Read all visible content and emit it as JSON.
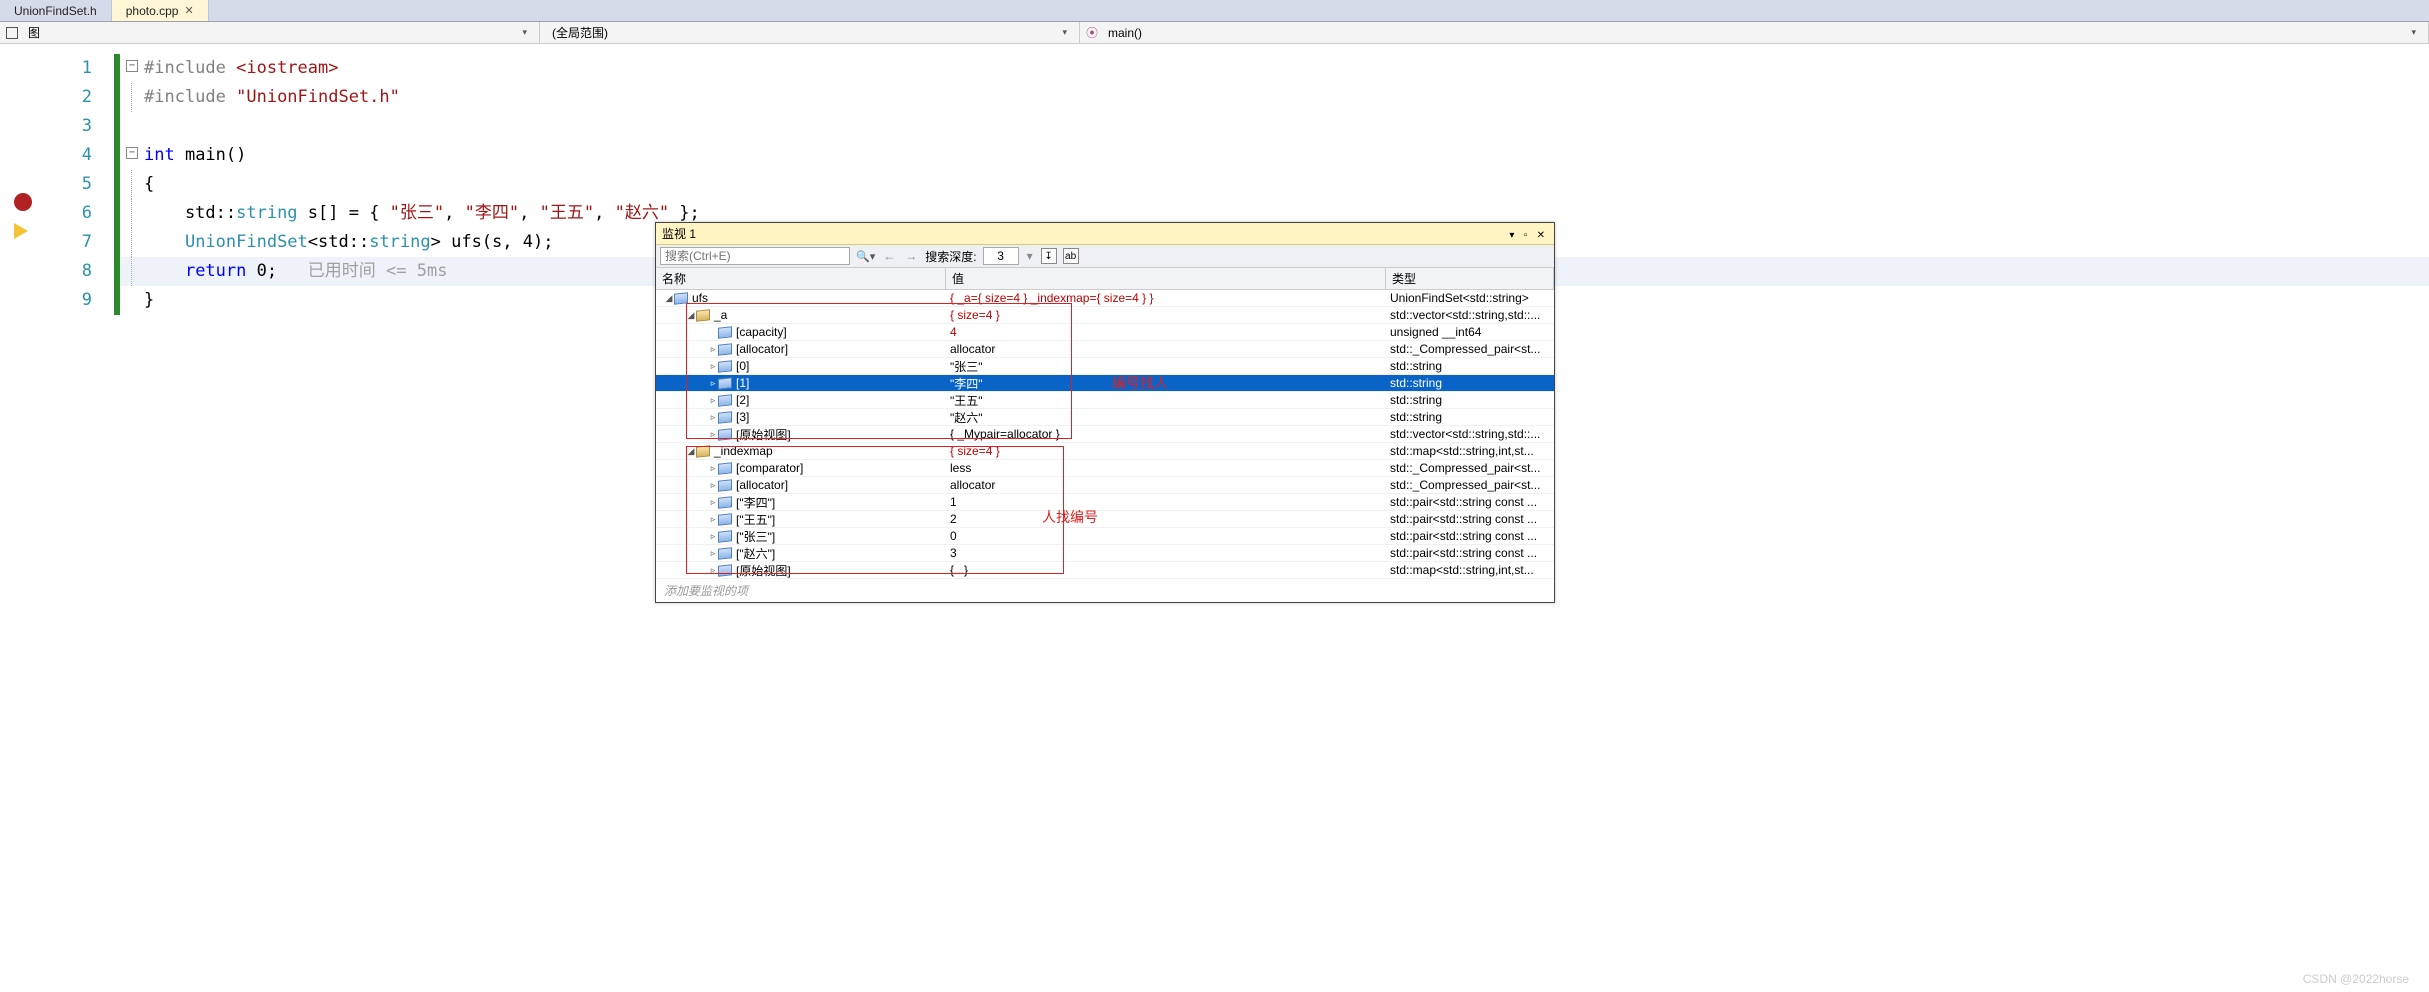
{
  "tabs": {
    "inactive": "UnionFindSet.h",
    "active": "photo.cpp",
    "close": "✕"
  },
  "nav": {
    "left_icon_label": "图",
    "mid": "(全局范围)",
    "right_icon": "⦿",
    "right": "main()"
  },
  "gutter": {
    "lines": [
      "1",
      "2",
      "3",
      "4",
      "5",
      "6",
      "7",
      "8",
      "9"
    ]
  },
  "code": {
    "l1a": "#include ",
    "l1b": "<iostream>",
    "l2a": "#include ",
    "l2b": "\"UnionFindSet.h\"",
    "l4a": "int",
    "l4b": " main()",
    "l5": "{",
    "l6a": "    std::",
    "l6b": "string",
    "l6c": " s[] = { ",
    "l6d": "\"张三\"",
    "l6e": ", ",
    "l6f": "\"李四\"",
    "l6g": ", ",
    "l6h": "\"王五\"",
    "l6i": ", ",
    "l6j": "\"赵六\"",
    "l6k": " };",
    "l7a": "    ",
    "l7b": "UnionFindSet",
    "l7c": "<std::",
    "l7d": "string",
    "l7e": "> ufs(s, ",
    "l7f": "4",
    "l7g": ");",
    "l8a": "    ",
    "l8b": "return",
    "l8c": " 0;   ",
    "l8d": "已用时间 <= 5ms",
    "l9": "}"
  },
  "watch": {
    "title": "监视 1",
    "search_placeholder": "搜索(Ctrl+E)",
    "depth_label": "搜索深度:",
    "depth_value": "3",
    "nav_back": "←",
    "nav_fwd": "→",
    "tool1": "↧",
    "tool2": "ab",
    "headers": {
      "name": "名称",
      "value": "值",
      "type": "类型"
    },
    "rows": [
      {
        "d": 0,
        "e": "▸",
        "nm": "ufs",
        "val": "{ _a={ size=4 } _indexmap={ size=4 } }",
        "vred": true,
        "ty": "UnionFindSet<std::string>",
        "open": true
      },
      {
        "d": 1,
        "e": "▸",
        "ico": "key",
        "nm": "_a",
        "val": "{ size=4 }",
        "vred": true,
        "ty": "std::vector<std::string,std::...",
        "open": true
      },
      {
        "d": 2,
        "e": "",
        "nm": "[capacity]",
        "val": "4",
        "vred": true,
        "ty": "unsigned __int64"
      },
      {
        "d": 2,
        "e": "▹",
        "nm": "[allocator]",
        "val": "allocator",
        "ty": "std::_Compressed_pair<st..."
      },
      {
        "d": 2,
        "e": "▹",
        "nm": "[0]",
        "val": "\"张三\"",
        "ty": "std::string"
      },
      {
        "d": 2,
        "e": "▹",
        "nm": "[1]",
        "val": "\"李四\"",
        "ty": "std::string",
        "sel": true
      },
      {
        "d": 2,
        "e": "▹",
        "nm": "[2]",
        "val": "\"王五\"",
        "ty": "std::string"
      },
      {
        "d": 2,
        "e": "▹",
        "nm": "[3]",
        "val": "\"赵六\"",
        "ty": "std::string"
      },
      {
        "d": 2,
        "e": "▹",
        "nm": "[原始视图]",
        "val": "{ _Mypair=allocator }",
        "ty": "std::vector<std::string,std::..."
      },
      {
        "d": 1,
        "e": "▸",
        "ico": "key",
        "nm": "_indexmap",
        "val": "{ size=4 }",
        "vred": true,
        "ty": "std::map<std::string,int,st...",
        "open": true
      },
      {
        "d": 2,
        "e": "▹",
        "nm": "[comparator]",
        "val": "less",
        "ty": "std::_Compressed_pair<st..."
      },
      {
        "d": 2,
        "e": "▹",
        "nm": "[allocator]",
        "val": "allocator",
        "ty": "std::_Compressed_pair<st..."
      },
      {
        "d": 2,
        "e": "▹",
        "nm": "[\"李四\"]",
        "val": "1",
        "ty": "std::pair<std::string const ..."
      },
      {
        "d": 2,
        "e": "▹",
        "nm": "[\"王五\"]",
        "val": "2",
        "ty": "std::pair<std::string const ..."
      },
      {
        "d": 2,
        "e": "▹",
        "nm": "[\"张三\"]",
        "val": "0",
        "ty": "std::pair<std::string const ..."
      },
      {
        "d": 2,
        "e": "▹",
        "nm": "[\"赵六\"]",
        "val": "3",
        "ty": "std::pair<std::string const ..."
      },
      {
        "d": 2,
        "e": "▹",
        "nm": "[原始视图]",
        "val": "{...}",
        "ty": "std::map<std::string,int,st..."
      }
    ],
    "add": "添加要监视的项"
  },
  "anno": {
    "t1": "编号找人",
    "t2": "人找编号"
  },
  "watermark": "CSDN @2022horse",
  "win": {
    "min": "▾",
    "pin": "▫",
    "close": "✕"
  }
}
